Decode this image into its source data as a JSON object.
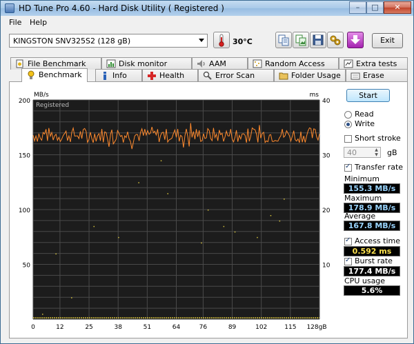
{
  "window": {
    "title": "HD Tune Pro 4.60 - Hard Disk Utility  ( Registered )",
    "controls": {
      "minimize": "–",
      "maximize": "□",
      "close": "✕"
    }
  },
  "menu": [
    "File",
    "Help"
  ],
  "toolbar": {
    "drive": "KINGSTON SNV325S2 (128 gB)",
    "temperature": "30°C",
    "exit": "Exit"
  },
  "tabs_top": [
    "File Benchmark",
    "Disk monitor",
    "AAM",
    "Random Access",
    "Extra tests"
  ],
  "tabs_bottom": [
    "Benchmark",
    "Info",
    "Health",
    "Error Scan",
    "Folder Usage",
    "Erase"
  ],
  "colors": {
    "transfer_line": "#ff8a2e",
    "access_points": "#d6c23c",
    "chart_bg": "#1c1c1c",
    "grid": "#4a4a4a"
  },
  "chart_data": {
    "type": "line",
    "watermark": "Registered",
    "y_left": {
      "unit": "MB/s",
      "range": [
        0,
        200
      ],
      "ticks": [
        200,
        150,
        100,
        50
      ]
    },
    "y_right": {
      "unit": "ms",
      "range": [
        0,
        40
      ],
      "ticks": [
        40,
        30,
        20,
        10
      ]
    },
    "x": {
      "unit": "gB",
      "range": [
        0,
        128
      ],
      "ticks": [
        "0",
        "12",
        "25",
        "38",
        "51",
        "64",
        "76",
        "89",
        "102",
        "115",
        "128gB"
      ]
    },
    "series": [
      {
        "name": "Transfer rate",
        "pattern": "noisy band between 155 and 179 MB/s, averaging ~168 MB/s"
      },
      {
        "name": "Access time",
        "points": [
          [
            4,
            1
          ],
          [
            10,
            12
          ],
          [
            17,
            4
          ],
          [
            27,
            17
          ],
          [
            38,
            15
          ],
          [
            47,
            25
          ],
          [
            57,
            29
          ],
          [
            60,
            23
          ],
          [
            75,
            14
          ],
          [
            78,
            20
          ],
          [
            85,
            17
          ],
          [
            90,
            16
          ],
          [
            100,
            15
          ],
          [
            106,
            19
          ],
          [
            110,
            18
          ],
          [
            112,
            22
          ]
        ]
      }
    ]
  },
  "side": {
    "start": "Start",
    "read": "Read",
    "write": "Write",
    "short_stroke": "Short stroke",
    "stroke_value": "40",
    "stroke_unit": "gB",
    "transfer_rate": "Transfer rate",
    "minimum_label": "Minimum",
    "minimum_value": "155.3 MB/s",
    "maximum_label": "Maximum",
    "maximum_value": "178.9 MB/s",
    "average_label": "Average",
    "average_value": "167.8 MB/s",
    "access_time_label": "Access time",
    "access_time_value": "0.592 ms",
    "burst_rate_label": "Burst rate",
    "burst_rate_value": "177.4 MB/s",
    "cpu_label": "CPU usage",
    "cpu_value": "5.6%"
  }
}
